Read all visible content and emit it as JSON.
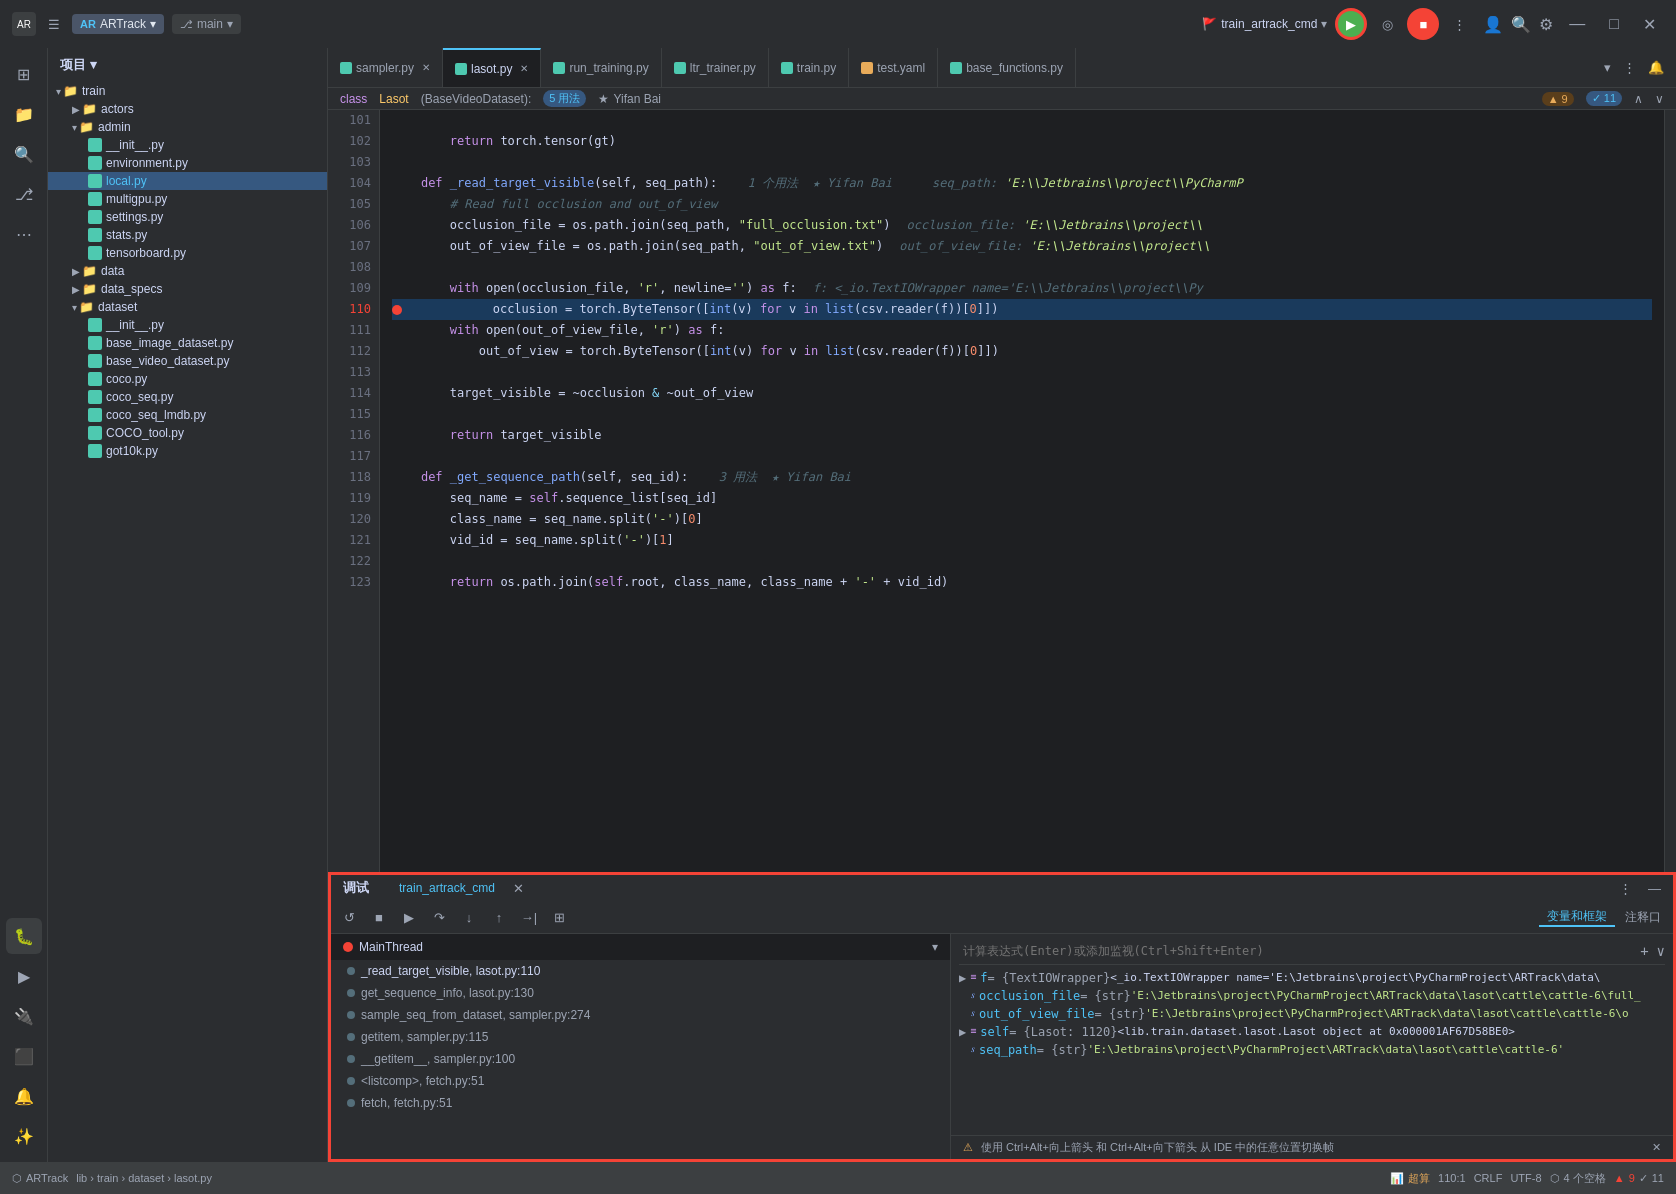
{
  "app": {
    "logo": "AR",
    "title": "ARTrack",
    "branch": "main",
    "run_config": "train_artrack_cmd",
    "window_controls": {
      "minimize": "—",
      "maximize": "□",
      "close": "✕"
    }
  },
  "titlebar": {
    "run_label": "train_artrack_cmd",
    "flag_icon": "🚩",
    "play_icon": "▶",
    "coverage_icon": "◎",
    "stop_icon": "■",
    "more_icon": "⋮",
    "search_icon": "🔍",
    "settings_icon": "⚙",
    "account_icon": "👤"
  },
  "tabs": [
    {
      "label": "sampler.py",
      "active": false,
      "closable": true
    },
    {
      "label": "lasot.py",
      "active": true,
      "closable": true
    },
    {
      "label": "run_training.py",
      "active": false,
      "closable": false
    },
    {
      "label": "ltr_trainer.py",
      "active": false,
      "closable": false
    },
    {
      "label": "train.py",
      "active": false,
      "closable": false
    },
    {
      "label": "test.yaml",
      "active": false,
      "closable": false
    },
    {
      "label": "base_functions.py",
      "active": false,
      "closable": false
    }
  ],
  "editor_info": {
    "class_name": "Lasot(BaseVideoDataset):",
    "usage_count": "5 用法",
    "user": "Yifan Bai",
    "errors": "▲ 9",
    "warnings": "✓ 11"
  },
  "code_lines": [
    {
      "num": 101,
      "content": "",
      "highlight": false,
      "breakpoint": false
    },
    {
      "num": 102,
      "content": "        return torch.tensor(gt)",
      "highlight": false,
      "breakpoint": false
    },
    {
      "num": 103,
      "content": "",
      "highlight": false,
      "breakpoint": false
    },
    {
      "num": 104,
      "content": "    def _read_target_visible(self, seq_path):  1 个用法  ★ Yifan Bai     seq_path: 'E:\\\\Jetbrains\\\\project\\\\PyCharmP",
      "highlight": false,
      "breakpoint": false
    },
    {
      "num": 105,
      "content": "        # Read full occlusion and out_of_view",
      "highlight": false,
      "breakpoint": false
    },
    {
      "num": 106,
      "content": "        occlusion_file = os.path.join(seq_path, \"full_occlusion.txt\")     occlusion_file: 'E:\\\\Jetbrains\\\\project\\\\",
      "highlight": false,
      "breakpoint": false
    },
    {
      "num": 107,
      "content": "        out_of_view_file = os.path.join(seq_path, \"out_of_view.txt\")      out_of_view_file: 'E:\\\\Jetbrains\\\\project\\\\",
      "highlight": false,
      "breakpoint": false
    },
    {
      "num": 108,
      "content": "",
      "highlight": false,
      "breakpoint": false
    },
    {
      "num": 109,
      "content": "        with open(occlusion_file, 'r', newline='') as f:   f: <_io.TextIOWrapper name='E:\\\\Jetbrains\\\\project\\\\Py",
      "highlight": false,
      "breakpoint": false
    },
    {
      "num": 110,
      "content": "            occlusion = torch.ByteTensor([int(v) for v in list(csv.reader(f))[0]])",
      "highlight": true,
      "breakpoint": true
    },
    {
      "num": 111,
      "content": "        with open(out_of_view_file, 'r') as f:",
      "highlight": false,
      "breakpoint": false
    },
    {
      "num": 112,
      "content": "            out_of_view = torch.ByteTensor([int(v) for v in list(csv.reader(f))[0]])",
      "highlight": false,
      "breakpoint": false
    },
    {
      "num": 113,
      "content": "",
      "highlight": false,
      "breakpoint": false
    },
    {
      "num": 114,
      "content": "        target_visible = ~occlusion & ~out_of_view",
      "highlight": false,
      "breakpoint": false
    },
    {
      "num": 115,
      "content": "",
      "highlight": false,
      "breakpoint": false
    },
    {
      "num": 116,
      "content": "        return target_visible",
      "highlight": false,
      "breakpoint": false
    },
    {
      "num": 117,
      "content": "",
      "highlight": false,
      "breakpoint": false
    },
    {
      "num": 118,
      "content": "    def _get_sequence_path(self, seq_id):  3 用法  ★ Yifan Bai",
      "highlight": false,
      "breakpoint": false
    },
    {
      "num": 119,
      "content": "        seq_name = self.sequence_list[seq_id]",
      "highlight": false,
      "breakpoint": false
    },
    {
      "num": 120,
      "content": "        class_name = seq_name.split('-')[0]",
      "highlight": false,
      "breakpoint": false
    },
    {
      "num": 121,
      "content": "        vid_id = seq_name.split('-')[1]",
      "highlight": false,
      "breakpoint": false
    },
    {
      "num": 122,
      "content": "",
      "highlight": false,
      "breakpoint": false
    },
    {
      "num": 123,
      "content": "        return os.path.join(self.root, class_name, class_name + '-' + vid_id)",
      "highlight": false,
      "breakpoint": false
    }
  ],
  "filetree": {
    "header": "项目 ▾",
    "items": [
      {
        "level": 0,
        "type": "folder",
        "label": "train",
        "expanded": true
      },
      {
        "level": 1,
        "type": "folder",
        "label": "actors",
        "expanded": false
      },
      {
        "level": 1,
        "type": "folder",
        "label": "admin",
        "expanded": true
      },
      {
        "level": 2,
        "type": "file",
        "label": "__init__.py",
        "ext": "py"
      },
      {
        "level": 2,
        "type": "file",
        "label": "environment.py",
        "ext": "py"
      },
      {
        "level": 2,
        "type": "file",
        "label": "local.py",
        "ext": "py",
        "active": true
      },
      {
        "level": 2,
        "type": "file",
        "label": "multigpu.py",
        "ext": "py"
      },
      {
        "level": 2,
        "type": "file",
        "label": "settings.py",
        "ext": "py"
      },
      {
        "level": 2,
        "type": "file",
        "label": "stats.py",
        "ext": "py"
      },
      {
        "level": 2,
        "type": "file",
        "label": "tensorboard.py",
        "ext": "py"
      },
      {
        "level": 1,
        "type": "folder",
        "label": "data",
        "expanded": false
      },
      {
        "level": 1,
        "type": "folder",
        "label": "data_specs",
        "expanded": false
      },
      {
        "level": 1,
        "type": "folder",
        "label": "dataset",
        "expanded": true
      },
      {
        "level": 2,
        "type": "file",
        "label": "__init__.py",
        "ext": "py"
      },
      {
        "level": 2,
        "type": "file",
        "label": "base_image_dataset.py",
        "ext": "py"
      },
      {
        "level": 2,
        "type": "file",
        "label": "base_video_dataset.py",
        "ext": "py"
      },
      {
        "level": 2,
        "type": "file",
        "label": "coco.py",
        "ext": "py"
      },
      {
        "level": 2,
        "type": "file",
        "label": "coco_seq.py",
        "ext": "py"
      },
      {
        "level": 2,
        "type": "file",
        "label": "coco_seq_lmdb.py",
        "ext": "py"
      },
      {
        "level": 2,
        "type": "file",
        "label": "COCO_tool.py",
        "ext": "py"
      },
      {
        "level": 2,
        "type": "file",
        "label": "got10k.py",
        "ext": "py"
      }
    ]
  },
  "bottom_panel": {
    "debug_tab": "调试",
    "run_config_tab": "train_artrack_cmd",
    "close_icon": "✕",
    "minimize_icon": "—",
    "maximize_icon": "□",
    "more_icon": "⋮",
    "thread_label": "MainThread",
    "stack_frames": [
      {
        "label": "_read_target_visible, lasot.py:110",
        "active": true
      },
      {
        "label": "get_sequence_info, lasot.py:130",
        "active": false
      },
      {
        "label": "sample_seq_from_dataset, sampler.py:274",
        "active": false
      },
      {
        "label": "getitem, sampler.py:115",
        "active": false
      },
      {
        "label": "__getitem__, sampler.py:100",
        "active": false
      },
      {
        "label": "<listcomp>, fetch.py:51",
        "active": false
      },
      {
        "label": "fetch, fetch.py:51",
        "active": false
      }
    ],
    "vars": [
      {
        "type": "obj",
        "name": "f",
        "value": "= {TextIOWrapper} <_io.TextIOWrapper name='E:\\\\Jetbrains\\\\project\\\\PyCharmProject\\\\ARTrack\\\\data\\\\",
        "expand": true
      },
      {
        "type": "str",
        "name": "occlusion_file",
        "value": "= {str} 'E:\\\\Jetbrains\\\\project\\\\PyCharmProject\\\\ARTrack\\\\data\\\\lasot\\\\cattle\\\\cattle-6\\\\full_",
        "expand": false
      },
      {
        "type": "str",
        "name": "out_of_view_file",
        "value": "= {str} 'E:\\\\Jetbrains\\\\project\\\\PyCharmProject\\\\ARTrack\\\\data\\\\lasot\\\\cattle\\\\cattle-6\\\\o",
        "expand": false
      },
      {
        "type": "obj",
        "name": "self",
        "value": "= {Lasot: 1120} <lib.train.dataset.lasot.Lasot object at 0x000001AF67D58BE0>",
        "expand": true
      },
      {
        "type": "str",
        "name": "seq_path",
        "value": "= {str} 'E:\\\\Jetbrains\\\\project\\\\PyCharmProject\\\\ARTrack\\\\data\\\\lasot\\\\cattle\\\\cattle-6'",
        "expand": false
      }
    ],
    "expression_placeholder": "计算表达式(Enter)或添加监视(Ctrl+Shift+Enter)",
    "toolbar_tabs": [
      {
        "label": "变量和框架",
        "active": true
      },
      {
        "label": "注释口",
        "active": false
      }
    ],
    "warning_text": "使用 Ctrl+Alt+向上箭头 和 Ctrl+Alt+向下箭头 从 IDE 中的任意位置切换帧"
  },
  "statusbar": {
    "project": "ARTrack",
    "breadcrumb": "lib › train › dataset › lasot.py",
    "position": "110:1",
    "encoding": "CRLF",
    "charset": "UTF-8",
    "indent": "4 个空格",
    "git_icon": "⬡",
    "errors_icon": "▲",
    "errors_count": "9",
    "warnings_count": "11",
    "mem_icon": "📊",
    "mem_label": "超算"
  },
  "colors": {
    "accent_blue": "#4fc3f7",
    "accent_green": "#4caf50",
    "accent_red": "#f44336",
    "accent_orange": "#e8ab5a",
    "bg_dark": "#1e1f22",
    "bg_panel": "#2b2d30",
    "highlight_line": "#1a3a5c",
    "breakpoint_red": "#f44336"
  }
}
